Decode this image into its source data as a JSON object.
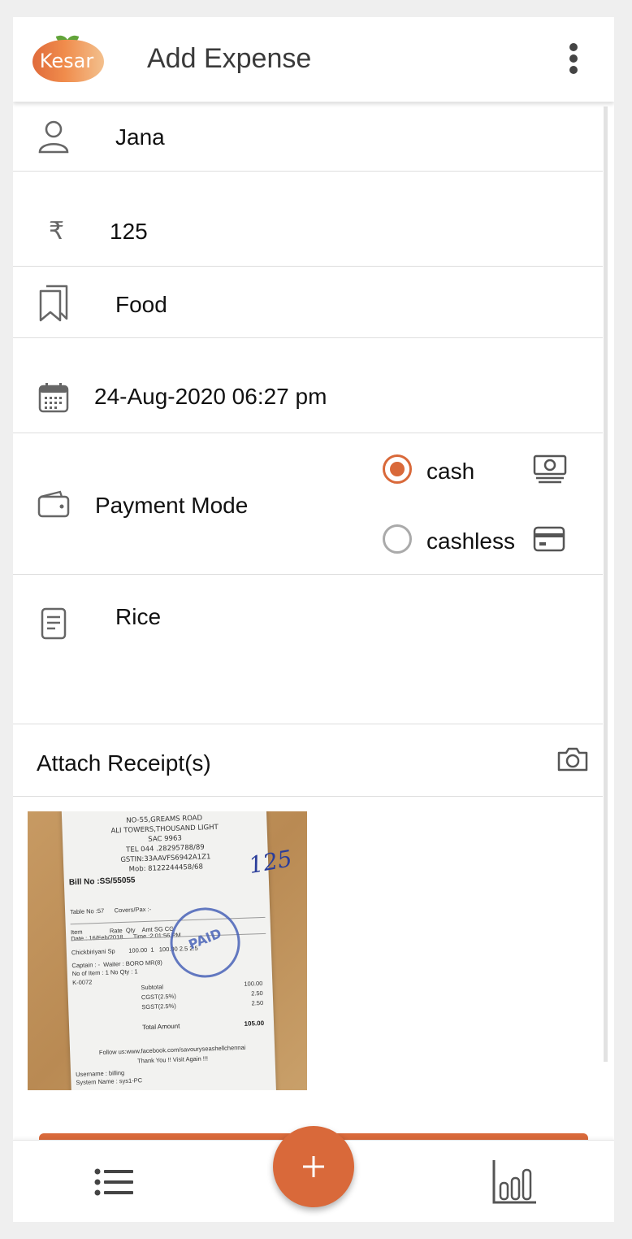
{
  "app": {
    "logo_text": "Kesar",
    "title": "Add Expense"
  },
  "form": {
    "name": "Jana",
    "amount": "125",
    "category": "Food",
    "datetime": "24-Aug-2020 06:27 pm",
    "payment_mode_label": "Payment Mode",
    "payment_options": [
      {
        "label": "cash",
        "selected": true,
        "icon": "cash-icon"
      },
      {
        "label": "cashless",
        "selected": false,
        "icon": "card-icon"
      }
    ],
    "note": "Rice",
    "attach_label": "Attach Receipt(s)"
  },
  "receipt": {
    "header_lines": [
      "NO-55,GREAMS ROAD",
      "ALI TOWERS,THOUSAND LIGHT",
      "SAC 9963",
      "TEL 044 .28295788/89",
      "GSTIN:33AAVFS6942A1Z1",
      "Mob: 8122244458/68"
    ],
    "bill_no": "Bill No :SS/55055",
    "table_line": "Table No :57      Covers/Pax :-",
    "date_line": "Date : 16/Feb/2018      Time :2:01:56 PM",
    "captain_line": "Captain : -  Waiter : BORO MR(8)",
    "columns_line": "Item                Rate  Qty    Amt SG CG",
    "item_line": "Chickbiriyani Sp        100.00  1   100.00 2.5 2.5",
    "count_line": "No of Item : 1   No Qty : 1",
    "kot_line": "K-0072",
    "totals": [
      {
        "label": "Subtotal",
        "value": "100.00"
      },
      {
        "label": "CGST(2.5%)",
        "value": "2.50"
      },
      {
        "label": "SGST(2.5%)",
        "value": "2.50"
      }
    ],
    "total_label": "Total Amount",
    "total_value": "105.00",
    "footer_lines": [
      "Follow us:www.facebook.com/savouryseashellchennai",
      "Thank You !! Visit Again !!!",
      "Username : billing",
      "System Name : sys1-PC"
    ],
    "stamp_text": "PAID",
    "handwritten": "125"
  },
  "colors": {
    "accent": "#d9693a",
    "divider": "#dedede",
    "text": "#111111"
  }
}
